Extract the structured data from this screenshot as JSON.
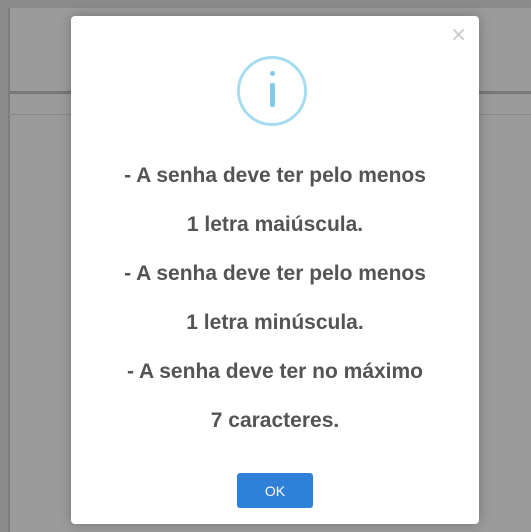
{
  "dialog": {
    "close_glyph": "×",
    "icon": "info-icon",
    "icon_color": "#a5dcf0",
    "message_lines": [
      "- A senha deve ter pelo menos",
      "1 letra maiúscula.",
      "- A senha deve ter pelo menos",
      "1 letra minúscula.",
      "- A senha deve ter no máximo",
      "7 caracteres."
    ],
    "ok_label": "OK",
    "ok_color": "#2f80d8"
  }
}
